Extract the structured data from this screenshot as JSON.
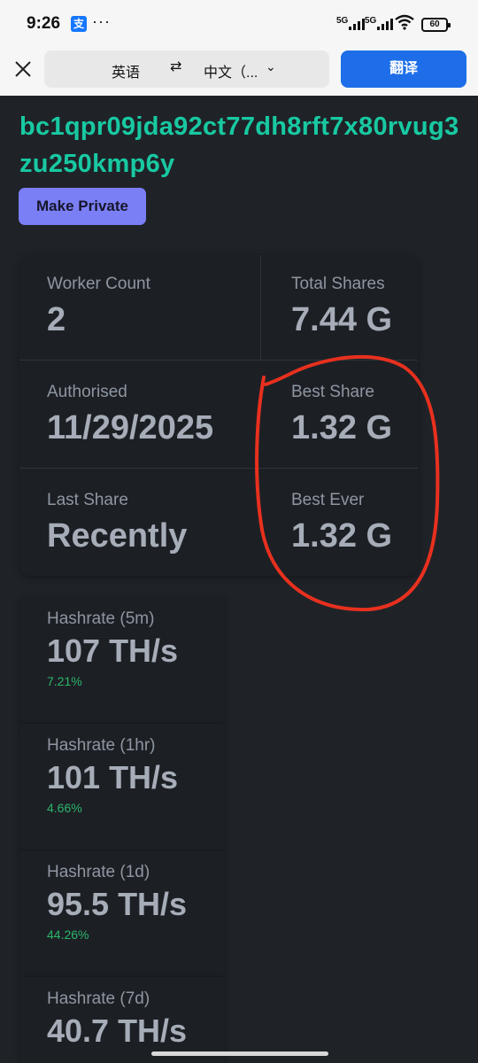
{
  "status": {
    "time": "9:26",
    "app_badge": "支",
    "dots": "···",
    "sig1": "5G",
    "sig2": "5G",
    "battery": "60"
  },
  "translate": {
    "source_lang": "英语",
    "swap": "⇄",
    "target_lang": "中文（...",
    "chevron": "⌄",
    "button": "翻译"
  },
  "address": "bc1qpr09jda92ct77dh8rft7x80rvug3zu250kmp6y",
  "make_private": "Make Private",
  "stats": {
    "worker_count": {
      "label": "Worker Count",
      "value": "2"
    },
    "total_shares": {
      "label": "Total Shares",
      "value": "7.44 G"
    },
    "authorised": {
      "label": "Authorised",
      "value": "11/29/2025"
    },
    "best_share": {
      "label": "Best Share",
      "value": "1.32 G"
    },
    "last_share": {
      "label": "Last Share",
      "value": "Recently"
    },
    "best_ever": {
      "label": "Best Ever",
      "value": "1.32 G"
    }
  },
  "hashrates": [
    {
      "label": "Hashrate (5m)",
      "value": "107 TH/s",
      "pct": "7.21%"
    },
    {
      "label": "Hashrate (1hr)",
      "value": "101 TH/s",
      "pct": "4.66%"
    },
    {
      "label": "Hashrate (1d)",
      "value": "95.5 TH/s",
      "pct": "44.26%"
    },
    {
      "label": "Hashrate (7d)",
      "value": "40.7 TH/s"
    }
  ],
  "colors": {
    "background": "#1f2328",
    "address": "#18c9a2",
    "button": "#7b7ff6",
    "translate": "#1d6ee8",
    "annotation": "#e8301e",
    "positive": "#2bb56a"
  }
}
